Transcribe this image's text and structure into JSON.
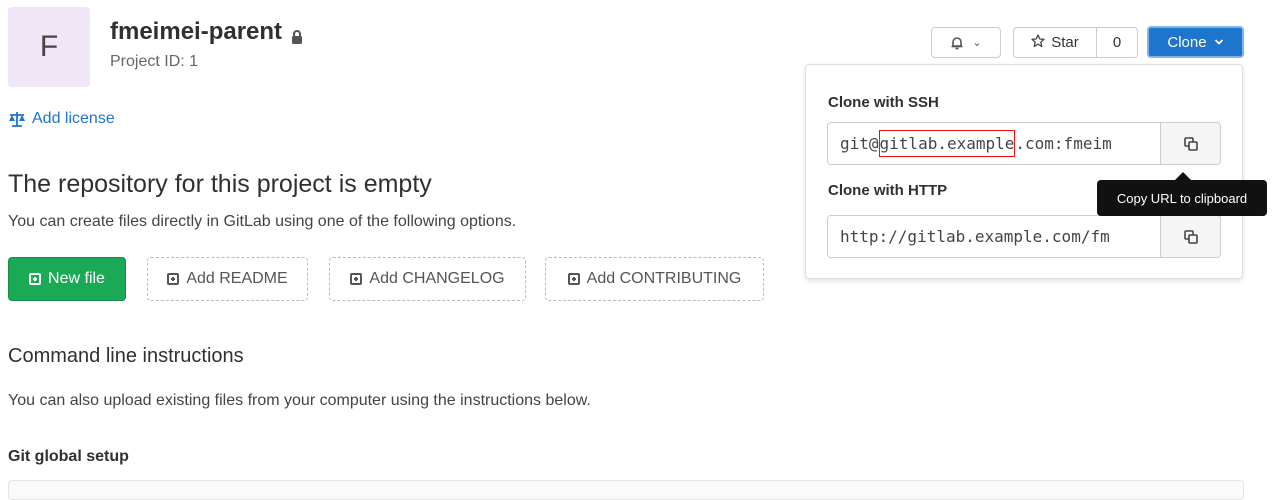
{
  "project": {
    "avatar_letter": "F",
    "name": "fmeimei-parent",
    "id_text": "Project ID: 1",
    "add_license": "Add license"
  },
  "repo": {
    "empty_title": "The repository for this project is empty",
    "empty_desc": "You can create files directly in GitLab using one of the following options."
  },
  "actions": {
    "new_file": "New file",
    "add_readme": "Add README",
    "add_changelog": "Add CHANGELOG",
    "add_contributing": "Add CONTRIBUTING"
  },
  "cli": {
    "title": "Command line instructions",
    "desc": "You can also upload existing files from your computer using the instructions below.",
    "git_global": "Git global setup"
  },
  "toolbar": {
    "star_label": "Star",
    "star_count": "0",
    "clone_label": "Clone"
  },
  "clone_dropdown": {
    "ssh_label": "Clone with SSH",
    "ssh_prefix": "git@",
    "ssh_highlight": "gitlab.example",
    "ssh_suffix": ".com:fmeim",
    "http_label": "Clone with HTTP",
    "http_url": "http://gitlab.example.com/fm"
  },
  "tooltip": {
    "text": "Copy URL to clipboard"
  },
  "colors": {
    "accent": "#1f75cb",
    "success": "#1aaa55",
    "highlight": "#ee1111"
  }
}
